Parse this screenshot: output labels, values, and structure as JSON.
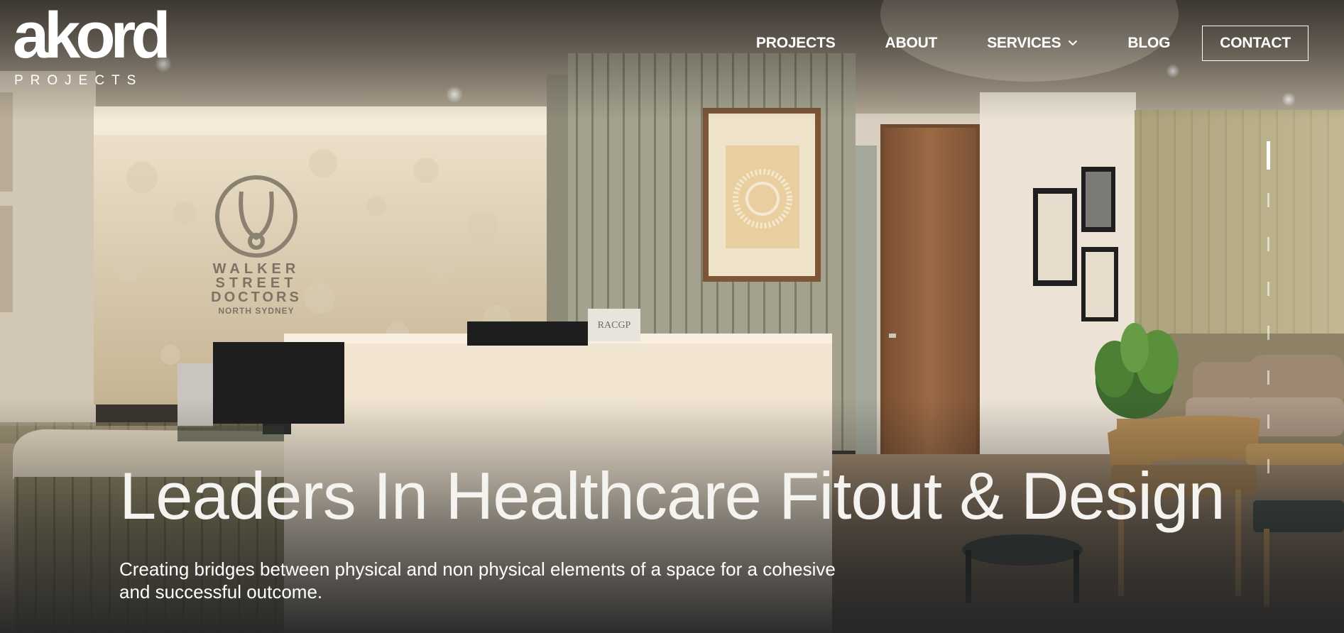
{
  "brand": {
    "logo_word": "akord",
    "logo_sub": "PROJECTS"
  },
  "nav": {
    "projects": "PROJECTS",
    "about": "ABOUT",
    "services": "SERVICES",
    "blog": "BLOG",
    "contact": "CONTACT"
  },
  "hero": {
    "headline": "Leaders In Healthcare Fitout & Design",
    "subtext": "Creating bridges between physical and non physical elements of a space for a cohesive and successful outcome.",
    "background_photo": {
      "signage_line1": "WALKER",
      "signage_line2": "STREET",
      "signage_line3": "DOCTORS",
      "signage_line4": "NORTH SYDNEY",
      "desk_plaque": "RACGP"
    }
  },
  "slider": {
    "slide_count": 8,
    "active_index": 0
  },
  "colors": {
    "text": "#ffffff",
    "overlay_dark": "#262626",
    "wall_warm": "#d8c9b0",
    "desk": "#efe3d0",
    "door_wood": "#8c5d3a",
    "accent_wall_green": "#b4ab7f"
  }
}
